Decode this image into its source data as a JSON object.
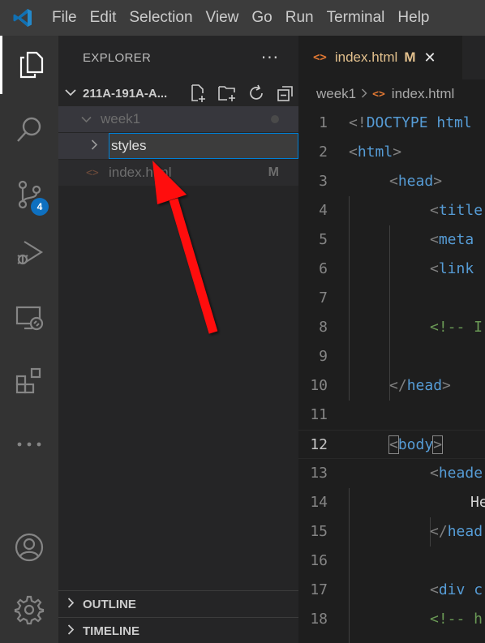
{
  "menu": [
    "File",
    "Edit",
    "Selection",
    "View",
    "Go",
    "Run",
    "Terminal",
    "Help"
  ],
  "activity": {
    "items": [
      "explorer-icon",
      "search-icon",
      "source-control-icon",
      "run-debug-icon",
      "remote-explorer-icon",
      "extensions-icon",
      "more-icon",
      "account-icon",
      "settings-gear-icon"
    ],
    "scm_badge": "4"
  },
  "explorer": {
    "title": "EXPLORER",
    "more": "···",
    "folder": "211A-191A-A...",
    "tree": {
      "week": "week1",
      "rename_value": "styles",
      "file": "index.html",
      "file_status": "M"
    },
    "panels": {
      "outline": "OUTLINE",
      "timeline": "TIMELINE"
    }
  },
  "editor": {
    "tab": {
      "icon": "<>",
      "label": "index.html",
      "status": "M",
      "close": "✕"
    },
    "breadcrumb": {
      "folder": "week1",
      "icon": "<>",
      "file": "index.html"
    },
    "line_numbers": [
      "1",
      "2",
      "3",
      "4",
      "5",
      "6",
      "7",
      "8",
      "9",
      "10",
      "11",
      "12",
      "13",
      "14",
      "15",
      "16",
      "17",
      "18"
    ],
    "current_line": "12",
    "code": {
      "l1a": "<!",
      "l1b": "DOCTYPE html",
      "l2a": "<",
      "l2b": "html",
      "l2c": ">",
      "l3a": "<",
      "l3b": "head",
      "l3c": ">",
      "l4a": "<",
      "l4b": "title",
      "l5a": "<",
      "l5b": "meta",
      "l6a": "<",
      "l6b": "link",
      "l8": "<!-- I",
      "l10a": "</",
      "l10b": "head",
      "l10c": ">",
      "l12a": "<",
      "l12b": "body",
      "l12c": ">",
      "l13a": "<",
      "l13b": "heade",
      "l14": "He",
      "l15a": "</",
      "l15b": "head",
      "l17a": "<",
      "l17b": "div",
      "l17c": "c",
      "l18": "<!-- h"
    }
  },
  "colors": {
    "titlebar": "#3c3c3c",
    "activitybar": "#333333",
    "sidebar": "#252526",
    "editor": "#1e1e1e",
    "accent": "#0e70c0",
    "arrow": "#ff0000",
    "modified": "#e2c08d"
  }
}
